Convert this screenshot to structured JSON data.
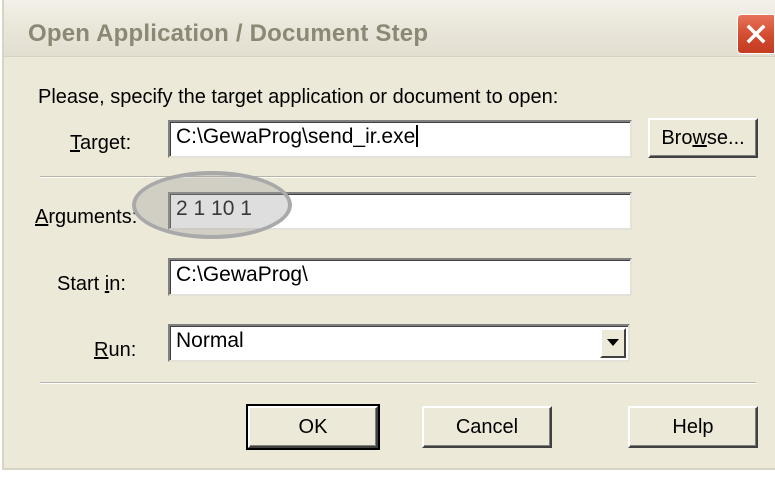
{
  "dialog": {
    "title": "Open Application / Document Step",
    "instruction": "Please, specify the target application or document to open:",
    "target": {
      "label_prefix": "",
      "label_mnemonic": "T",
      "label_suffix": "arget:",
      "value": "C:\\GewaProg\\send_ir.exe"
    },
    "browse_button": {
      "label_prefix": "Bro",
      "label_mnemonic": "w",
      "label_suffix": "se..."
    },
    "arguments": {
      "label_mnemonic": "A",
      "label_suffix": "rguments:",
      "value": "2 1 10 1"
    },
    "start_in": {
      "label_prefix": "Start ",
      "label_mnemonic": "i",
      "label_suffix": "n:",
      "value": "C:\\GewaProg\\"
    },
    "run": {
      "label_mnemonic": "R",
      "label_suffix": "un:",
      "selected": "Normal"
    },
    "buttons": {
      "ok": "OK",
      "cancel": "Cancel",
      "help": "Help"
    }
  },
  "colors": {
    "dialog_bg": "#ece9d8",
    "close_button": "#d14b2f",
    "title_text": "#8b8975"
  },
  "icons": {
    "close": "close-icon",
    "dropdown": "chevron-down-icon"
  }
}
